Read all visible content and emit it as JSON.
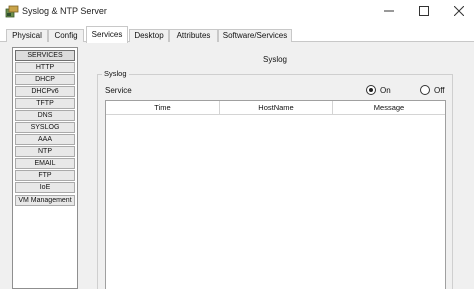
{
  "window": {
    "title": "Syslog & NTP Server",
    "icon": "packet-tracer-server-icon"
  },
  "tabs": [
    {
      "label": "Physical",
      "active": false
    },
    {
      "label": "Config",
      "active": false
    },
    {
      "label": "Services",
      "active": true
    },
    {
      "label": "Desktop",
      "active": false
    },
    {
      "label": "Attributes",
      "active": false
    },
    {
      "label": "Software/Services",
      "active": false
    }
  ],
  "sidebar": {
    "items": [
      {
        "label": "SERVICES",
        "selected": true
      },
      {
        "label": "HTTP",
        "selected": false
      },
      {
        "label": "DHCP",
        "selected": false
      },
      {
        "label": "DHCPv6",
        "selected": false
      },
      {
        "label": "TFTP",
        "selected": false
      },
      {
        "label": "DNS",
        "selected": false
      },
      {
        "label": "SYSLOG",
        "selected": false
      },
      {
        "label": "AAA",
        "selected": false
      },
      {
        "label": "NTP",
        "selected": false
      },
      {
        "label": "EMAIL",
        "selected": false
      },
      {
        "label": "FTP",
        "selected": false
      },
      {
        "label": "IoE",
        "selected": false
      },
      {
        "label": "VM Management",
        "selected": false
      }
    ]
  },
  "main": {
    "title": "Syslog",
    "group_label": "Syslog",
    "service_label": "Service",
    "service_state": "On",
    "radio_on_label": "On",
    "radio_off_label": "Off",
    "table": {
      "columns": [
        "Time",
        "HostName",
        "Message"
      ],
      "rows": []
    }
  }
}
